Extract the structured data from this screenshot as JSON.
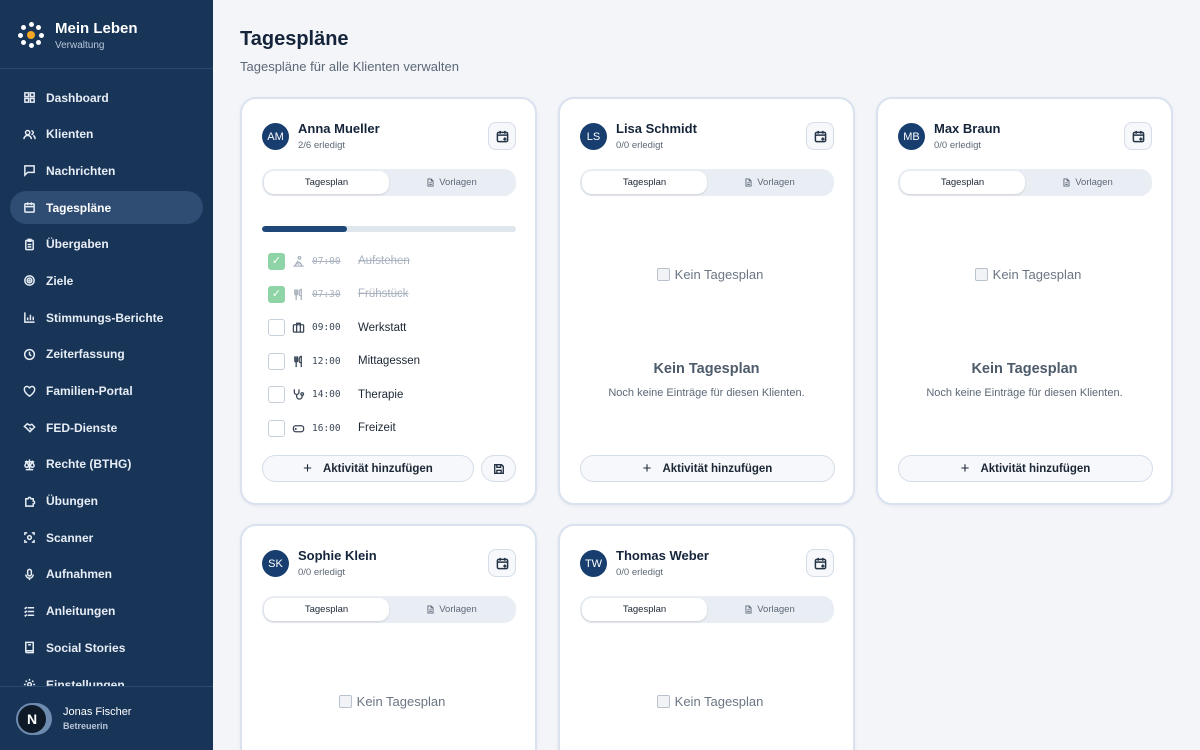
{
  "brand": {
    "title": "Mein Leben",
    "subtitle": "Verwaltung"
  },
  "nav": [
    {
      "label": "Dashboard",
      "icon": "grid-icon"
    },
    {
      "label": "Klienten",
      "icon": "users-icon"
    },
    {
      "label": "Nachrichten",
      "icon": "message-icon"
    },
    {
      "label": "Tagespläne",
      "icon": "calendar-icon",
      "active": true
    },
    {
      "label": "Übergaben",
      "icon": "clipboard-icon"
    },
    {
      "label": "Ziele",
      "icon": "target-icon"
    },
    {
      "label": "Stimmungs-Berichte",
      "icon": "bar-chart-icon"
    },
    {
      "label": "Zeiterfassung",
      "icon": "clock-icon"
    },
    {
      "label": "Familien-Portal",
      "icon": "heart-icon"
    },
    {
      "label": "FED-Dienste",
      "icon": "handshake-icon"
    },
    {
      "label": "Rechte (BTHG)",
      "icon": "scale-icon"
    },
    {
      "label": "Übungen",
      "icon": "puzzle-icon"
    },
    {
      "label": "Scanner",
      "icon": "scan-icon"
    },
    {
      "label": "Aufnahmen",
      "icon": "mic-icon"
    },
    {
      "label": "Anleitungen",
      "icon": "list-icon"
    },
    {
      "label": "Social Stories",
      "icon": "book-icon"
    },
    {
      "label": "Einstellungen",
      "icon": "settings-icon"
    }
  ],
  "user": {
    "initial": "N",
    "name": "Jonas Fischer",
    "role": "Betreuerin"
  },
  "page": {
    "title": "Tagespläne",
    "subtitle": "Tagespläne für alle Klienten verwalten"
  },
  "tabs": {
    "plan": "Tagesplan",
    "templates": "Vorlagen"
  },
  "add_label": "Aktivität hinzufügen",
  "empty": {
    "image_alt": "Kein Tagesplan",
    "title": "Kein Tagesplan",
    "text": "Noch keine Einträge für diesen Klienten."
  },
  "cards": [
    {
      "initials": "AM",
      "name": "Anna Mueller",
      "done": "2/6 erledigt",
      "progress": 0.333,
      "activities": [
        {
          "time": "07:00",
          "title": "Aufstehen",
          "done": true,
          "icon": "person-bed-icon"
        },
        {
          "time": "07:30",
          "title": "Frühstück",
          "done": true,
          "icon": "utensils-icon"
        },
        {
          "time": "09:00",
          "title": "Werkstatt",
          "done": false,
          "icon": "briefcase-icon"
        },
        {
          "time": "12:00",
          "title": "Mittagessen",
          "done": false,
          "icon": "utensils-icon"
        },
        {
          "time": "14:00",
          "title": "Therapie",
          "done": false,
          "icon": "stethoscope-icon"
        },
        {
          "time": "16:00",
          "title": "Freizeit",
          "done": false,
          "icon": "gamepad-icon"
        }
      ]
    },
    {
      "initials": "LS",
      "name": "Lisa Schmidt",
      "done": "0/0 erledigt"
    },
    {
      "initials": "MB",
      "name": "Max Braun",
      "done": "0/0 erledigt"
    },
    {
      "initials": "SK",
      "name": "Sophie Klein",
      "done": "0/0 erledigt"
    },
    {
      "initials": "TW",
      "name": "Thomas Weber",
      "done": "0/0 erledigt"
    }
  ]
}
